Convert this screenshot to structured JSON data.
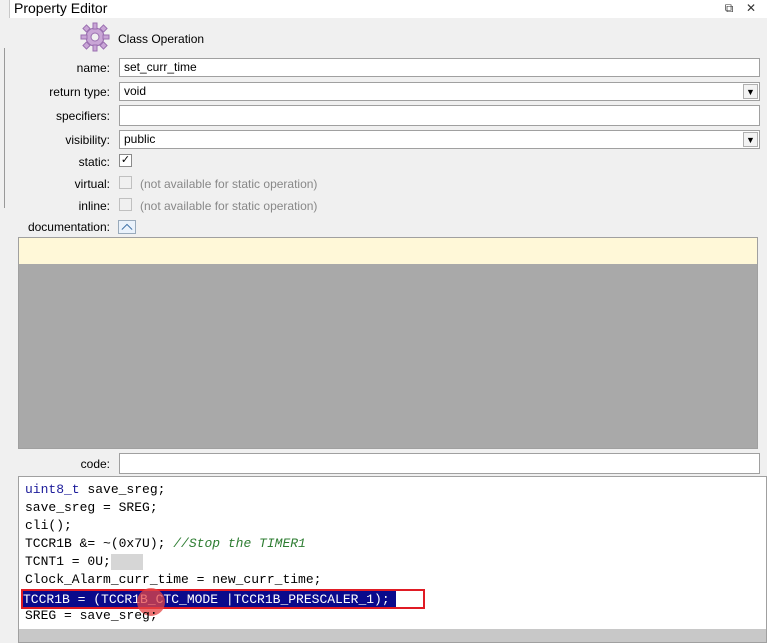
{
  "window": {
    "title": "Property Editor",
    "pin_icon": "pin-icon",
    "close_glyph": "✕",
    "pin_glyph": "⧉"
  },
  "header": {
    "icon": "gear-icon",
    "label": "Class Operation"
  },
  "fields": {
    "name": {
      "label": "name:",
      "value": "set_curr_time"
    },
    "return_type": {
      "label": "return type:",
      "value": "void"
    },
    "specifiers": {
      "label": "specifiers:",
      "value": ""
    },
    "visibility": {
      "label": "visibility:",
      "value": "public"
    },
    "static": {
      "label": "static:",
      "checked": true
    },
    "virtual": {
      "label": "virtual:",
      "checked": false,
      "note": "(not available for static operation)"
    },
    "inline": {
      "label": "inline:",
      "checked": false,
      "note": "(not available for static operation)"
    },
    "documentation": {
      "label": "documentation:"
    },
    "code": {
      "label": "code:",
      "value": ""
    }
  },
  "code_lines": [
    {
      "kw": "uint8_t",
      "text": " save_sreg;"
    },
    {
      "text": "save_sreg = SREG;"
    },
    {
      "text": "cli();"
    },
    {
      "text": "TCCR1B &= ~(0x7U); ",
      "comment": "//Stop the TIMER1"
    },
    {
      "text": "TCNT1 = 0U;"
    },
    {
      "text": "Clock_Alarm_curr_time = new_curr_time;"
    },
    {
      "text": "TCCR1B = (TCCR1B_CTC_MODE |TCCR1B_PRESCALER_1);"
    },
    {
      "text": "SREG = save_sreg;"
    }
  ],
  "colors": {
    "selection": "#0a0a8c",
    "highlight_box": "#e01b24",
    "doc_highlight": "#fff8d8"
  }
}
